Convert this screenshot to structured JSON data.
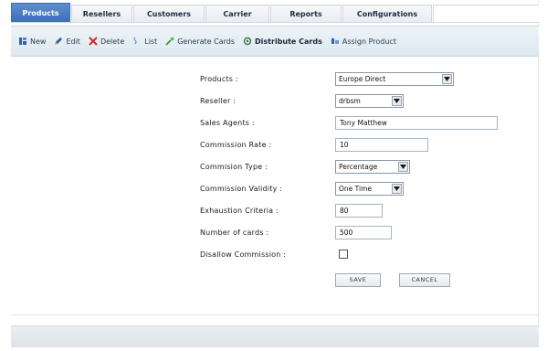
{
  "tabs": [
    {
      "label": "Products",
      "active": true
    },
    {
      "label": "Resellers",
      "active": false
    },
    {
      "label": "Customers",
      "active": false
    },
    {
      "label": "Carrier",
      "active": false
    },
    {
      "label": "Reports",
      "active": false
    },
    {
      "label": "Configurations",
      "active": false
    }
  ],
  "toolbar": {
    "new_label": "New",
    "edit_label": "Edit",
    "delete_label": "Delete",
    "list_label": "List",
    "generate_label": "Generate Cards",
    "distribute_label": "Distribute Cards",
    "assign_label": "Assign Product"
  },
  "form": {
    "products": {
      "label": "Products :",
      "value": "Europe Direct"
    },
    "reseller": {
      "label": "Reseller :",
      "value": "drbsm"
    },
    "sales_agents": {
      "label": "Sales Agents :",
      "value": "Tony Matthew"
    },
    "commission_rate": {
      "label": "Commission Rate :",
      "value": "10"
    },
    "commission_type": {
      "label": "Commision Type :",
      "value": "Percentage"
    },
    "commission_validity": {
      "label": "Commission Validity :",
      "value": "One Time"
    },
    "exhaustion_criteria": {
      "label": "Exhaustion Criteria :",
      "value": "80"
    },
    "number_of_cards": {
      "label": "Number of cards :",
      "value": "500"
    },
    "disallow_commission": {
      "label": "Disallow Commission :",
      "checked": false
    }
  },
  "buttons": {
    "save_label": "SAVE",
    "cancel_label": "CANCEL"
  },
  "colors": {
    "active_tab": "#3d6fb6",
    "toolbar_bg": "#e4edf3",
    "delete_icon": "#d42a2a"
  }
}
